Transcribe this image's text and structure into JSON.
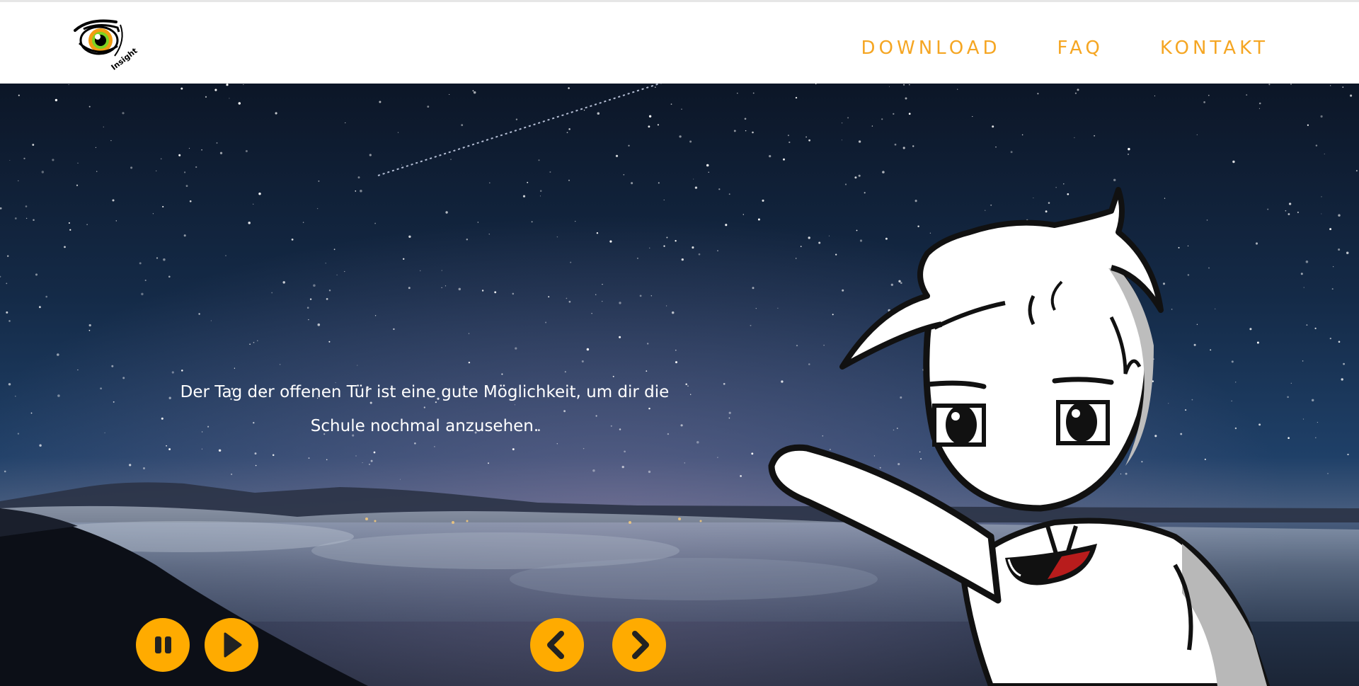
{
  "header": {
    "logo": {
      "icon": "eye-logo-icon",
      "text": "Insight"
    },
    "nav": [
      {
        "label": "DOWNLOAD"
      },
      {
        "label": "FAQ"
      },
      {
        "label": "KONTAKT"
      }
    ]
  },
  "hero": {
    "text_line1": "Der Tag der offenen Tür ist eine gute Möglichkeit, um dir die",
    "text_line2": "Schule nochmal anzusehen.",
    "controls": {
      "pause_icon": "pause-icon",
      "play_icon": "play-icon",
      "prev_icon": "chevron-left-icon",
      "next_icon": "chevron-right-icon"
    },
    "mascot": "cartoon-character-waving"
  },
  "colors": {
    "accent": "#ffab00",
    "nav_text": "#f5a623",
    "sky_top": "#0d1a2e",
    "sky_mid": "#1d3b5e",
    "horizon": "#5a6f8a",
    "mouth": "#b81c1c"
  }
}
